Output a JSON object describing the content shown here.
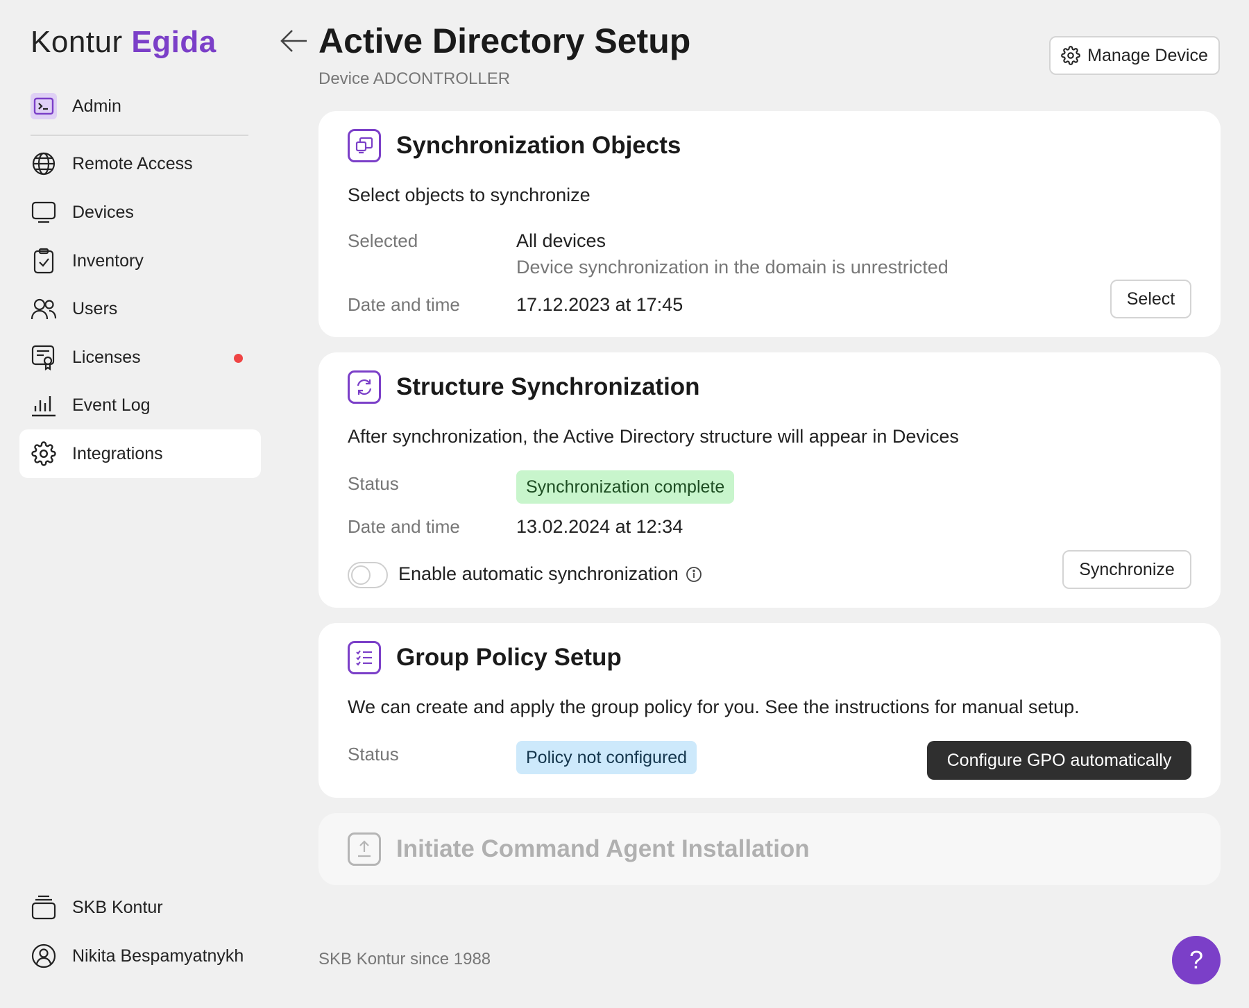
{
  "app": {
    "brand_part1": "Kontur",
    "brand_part2": "Egida",
    "accent": "#7b3fc8"
  },
  "sidebar": {
    "admin": {
      "label": "Admin",
      "icon": "terminal-icon"
    },
    "items": [
      {
        "label": "Remote Access",
        "icon": "globe-icon"
      },
      {
        "label": "Devices",
        "icon": "monitor-icon"
      },
      {
        "label": "Inventory",
        "icon": "clipboard-check-icon"
      },
      {
        "label": "Users",
        "icon": "users-icon"
      },
      {
        "label": "Licenses",
        "icon": "certificate-icon",
        "notification": true
      },
      {
        "label": "Event Log",
        "icon": "bar-chart-icon"
      },
      {
        "label": "Integrations",
        "icon": "gear-icon",
        "active": true
      }
    ],
    "bottom": [
      {
        "label": "SKB Kontur",
        "icon": "stack-icon"
      },
      {
        "label": "Nikita Bespamyatnykh",
        "icon": "user-circle-icon"
      }
    ]
  },
  "header": {
    "title": "Active Directory Setup",
    "subtitle": "Device ADCONTROLLER",
    "manage_label": "Manage Device"
  },
  "sync_objects": {
    "title": "Synchronization Objects",
    "description": "Select objects to synchronize",
    "selected_label": "Selected",
    "selected_value": "All devices",
    "selected_note": "Device synchronization in the domain is unrestricted",
    "datetime_label": "Date and time",
    "datetime_value": "17.12.2023 at 17:45",
    "button": "Select"
  },
  "structure_sync": {
    "title": "Structure Synchronization",
    "description": "After synchronization, the Active Directory structure will appear in Devices",
    "status_label": "Status",
    "status_value": "Synchronization complete",
    "datetime_label": "Date and time",
    "datetime_value": "13.02.2024 at 12:34",
    "toggle_label": "Enable automatic synchronization",
    "toggle_on": false,
    "button": "Synchronize"
  },
  "group_policy": {
    "title": "Group Policy Setup",
    "description": "We can create and apply the group policy for you. See the instructions for manual setup.",
    "status_label": "Status",
    "status_value": "Policy not configured",
    "button": "Configure GPO automatically"
  },
  "agent_install": {
    "title": "Initiate Command Agent Installation"
  },
  "footer": {
    "text": "SKB Kontur since 1988",
    "help": "?"
  }
}
